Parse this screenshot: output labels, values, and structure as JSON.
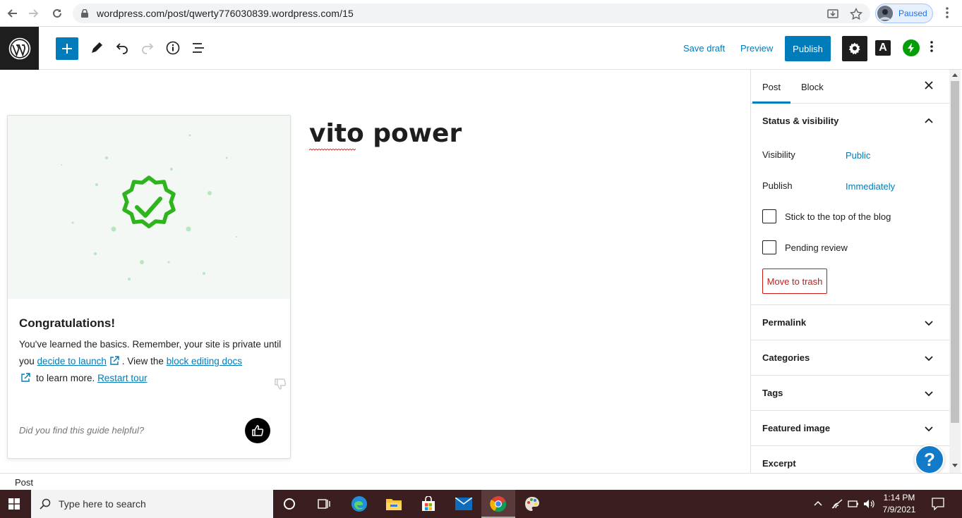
{
  "browser": {
    "url": "wordpress.com/post/qwerty776030839.wordpress.com/15",
    "profile_status": "Paused"
  },
  "editor_header": {
    "save_draft": "Save draft",
    "preview": "Preview",
    "publish": "Publish",
    "amp_label": "A"
  },
  "post": {
    "title": "vito power"
  },
  "guide": {
    "heading": "Congratulations!",
    "text_1": "You've learned the basics. Remember, your site is private until you",
    "link_launch": "decide to launch",
    "text_2": ". View the",
    "link_docs": "block editing docs",
    "text_3": "to learn more.",
    "link_restart": "Restart tour",
    "feedback_question": "Did you find this guide helpful?"
  },
  "sidebar": {
    "tabs": [
      {
        "label": "Post",
        "active": true
      },
      {
        "label": "Block",
        "active": false
      }
    ],
    "status_panel": {
      "title": "Status & visibility",
      "visibility_label": "Visibility",
      "visibility_value": "Public",
      "publish_label": "Publish",
      "publish_value": "Immediately",
      "sticky_label": "Stick to the top of the blog",
      "pending_label": "Pending review",
      "trash_label": "Move to trash"
    },
    "panels": [
      {
        "title": "Permalink"
      },
      {
        "title": "Categories"
      },
      {
        "title": "Tags"
      },
      {
        "title": "Featured image"
      },
      {
        "title": "Excerpt"
      }
    ]
  },
  "help_button": "?",
  "footer": {
    "breadcrumb": "Post"
  },
  "taskbar": {
    "search_placeholder": "Type here to search",
    "time": "1:14 PM",
    "date": "7/9/2021"
  },
  "colors": {
    "wp_blue": "#007cba",
    "trash_red": "#cc1818",
    "jetpack_green": "#069e08",
    "success_green": "#2fb41f",
    "taskbar_bg": "#3b1f20"
  }
}
